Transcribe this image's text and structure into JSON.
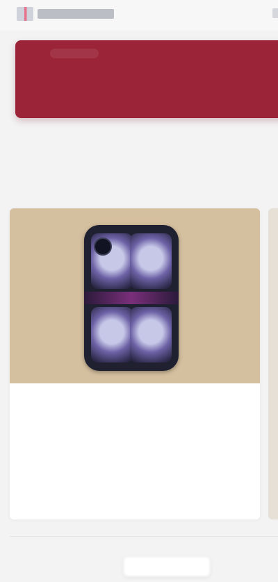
{
  "header": {
    "logo_label": ""
  },
  "banner": {
    "text": ""
  },
  "heading": {
    "line1": "",
    "line2": ""
  },
  "product": {
    "title": "",
    "subtitle": "",
    "subtitle2": "",
    "description": ""
  },
  "footer": {
    "button_label": ""
  },
  "colors": {
    "banner": "#9b2438",
    "card_image_bg": "#d4bf9e",
    "page_bg": "#f3f3f4"
  },
  "icons": {
    "logo": "brand-logo-icon"
  }
}
